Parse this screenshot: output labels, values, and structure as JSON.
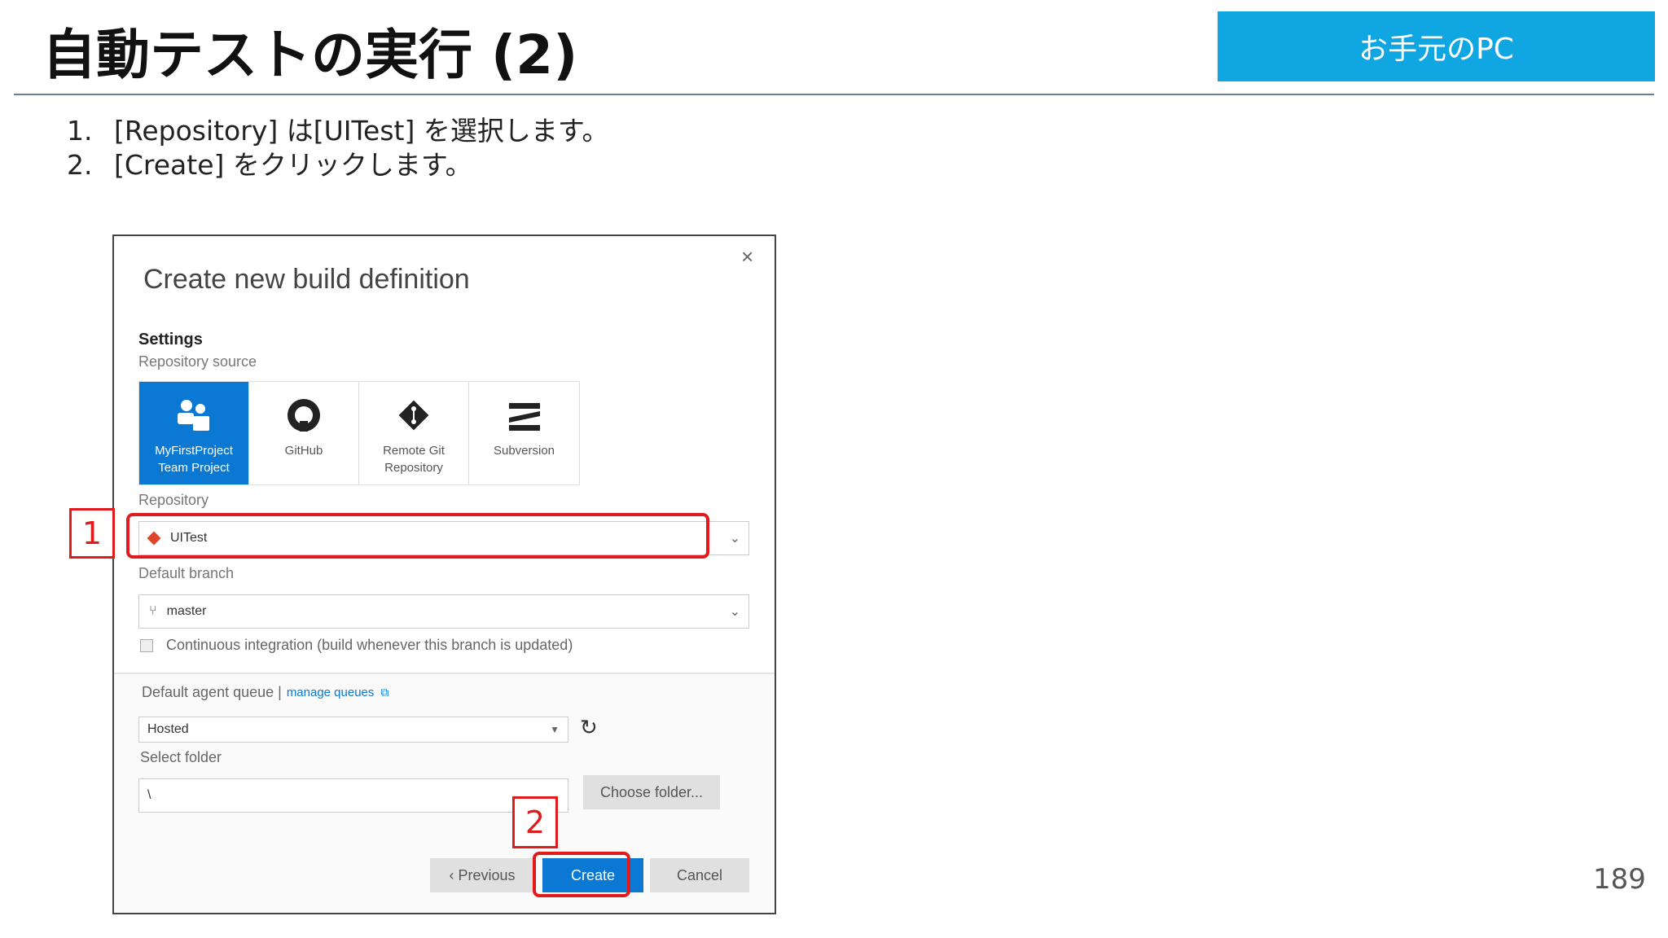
{
  "slide": {
    "title": "自動テストの実行 (2)",
    "environment_badge": "お手元のPC",
    "steps": [
      {
        "num": "1.",
        "text": "[Repository] は[UITest] を選択します。"
      },
      {
        "num": "2.",
        "text": "[Create] をクリックします。"
      }
    ],
    "page_number": "189"
  },
  "dialog": {
    "title": "Create new build definition",
    "close": "×",
    "settings_label": "Settings",
    "repo_source_label": "Repository source",
    "sources": [
      {
        "label_line1": "MyFirstProject",
        "label_line2": "Team Project",
        "icon": "team-project-icon",
        "selected": true
      },
      {
        "label_line1": "GitHub",
        "label_line2": "",
        "icon": "github-icon",
        "selected": false
      },
      {
        "label_line1": "Remote Git",
        "label_line2": "Repository",
        "icon": "git-icon",
        "selected": false
      },
      {
        "label_line1": "Subversion",
        "label_line2": "",
        "icon": "subversion-icon",
        "selected": false
      }
    ],
    "repository_label": "Repository",
    "repository_value": "UITest",
    "default_branch_label": "Default branch",
    "default_branch_value": "master",
    "ci_label": "Continuous integration (build whenever this branch is updated)",
    "ci_checked": false,
    "agent_queue_label": "Default agent queue |",
    "manage_queues_link": "manage queues",
    "agent_queue_value": "Hosted",
    "select_folder_label": "Select folder",
    "folder_value": "\\",
    "choose_folder_button": "Choose folder...",
    "previous_button": "‹ Previous",
    "create_button": "Create",
    "cancel_button": "Cancel"
  },
  "callouts": [
    {
      "label": "1"
    },
    {
      "label": "2"
    }
  ],
  "colors": {
    "accent": "#0b78d3",
    "badge": "#10a6e2",
    "callout": "#e01b1b"
  }
}
